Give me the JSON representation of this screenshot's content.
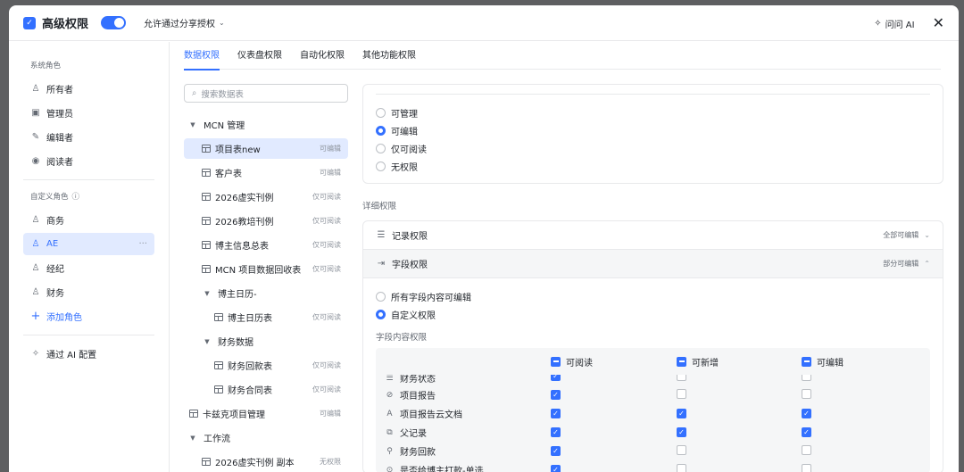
{
  "header": {
    "title": "高级权限",
    "share_label": "允许通过分享授权",
    "ask_ai": "问问 AI"
  },
  "sidebar": {
    "system_label": "系统角色",
    "system_roles": [
      "所有者",
      "管理员",
      "编辑者",
      "阅读者"
    ],
    "custom_label": "自定义角色",
    "custom_roles": [
      "商务",
      "AE",
      "经纪",
      "财务"
    ],
    "more": "···",
    "add_role": "添加角色",
    "ai_config": "通过 AI 配置"
  },
  "tabs": [
    "数据权限",
    "仪表盘权限",
    "自动化权限",
    "其他功能权限"
  ],
  "tree": {
    "search_placeholder": "搜索数据表",
    "nodes": [
      {
        "label": "MCN 管理",
        "perm": ""
      },
      {
        "label": "项目表new",
        "perm": "可编辑"
      },
      {
        "label": "客户表",
        "perm": "可编辑"
      },
      {
        "label": "2026虚实刊例",
        "perm": "仅可阅读"
      },
      {
        "label": "2026教培刊例",
        "perm": "仅可阅读"
      },
      {
        "label": "博主信息总表",
        "perm": "仅可阅读"
      },
      {
        "label": "MCN 项目数据回收表",
        "perm": "仅可阅读"
      },
      {
        "label": "博主日历-",
        "perm": ""
      },
      {
        "label": "博主日历表",
        "perm": "仅可阅读"
      },
      {
        "label": "财务数据",
        "perm": ""
      },
      {
        "label": "财务回款表",
        "perm": "仅可阅读"
      },
      {
        "label": "财务合同表",
        "perm": "仅可阅读"
      },
      {
        "label": "卡兹克项目管理",
        "perm": "可编辑"
      },
      {
        "label": "工作流",
        "perm": ""
      },
      {
        "label": "2026虚实刊例 副本",
        "perm": "无权限"
      }
    ]
  },
  "table_perm": {
    "options": [
      "可管理",
      "可编辑",
      "仅可阅读",
      "无权限"
    ],
    "selected": "可编辑"
  },
  "detail": {
    "label": "详细权限",
    "record": {
      "title": "记录权限",
      "value": "全部可编辑"
    },
    "field": {
      "title": "字段权限",
      "value": "部分可编辑"
    },
    "field_options": [
      "所有字段内容可编辑",
      "自定义权限"
    ],
    "field_selected": "自定义权限",
    "field_content_label": "字段内容权限",
    "columns": [
      "可阅读",
      "可新增",
      "可编辑"
    ],
    "partial_row": "财务状态",
    "rows": [
      {
        "name": "项目报告",
        "icon": "attachment-icon",
        "read": true,
        "add": false,
        "edit": false
      },
      {
        "name": "项目报告云文档",
        "icon": "text-format-icon",
        "read": true,
        "add": true,
        "edit": true
      },
      {
        "name": "父记录",
        "icon": "link-record-icon",
        "read": true,
        "add": true,
        "edit": true
      },
      {
        "name": "财务回款",
        "icon": "lookup-icon",
        "read": true,
        "add": false,
        "edit": false
      },
      {
        "name": "是否给博主打款-单选",
        "icon": "single-select-icon",
        "read": true,
        "add": false,
        "edit": false
      }
    ]
  },
  "colors": {
    "accent": "#3370ff",
    "active_bg": "#e1eaff"
  }
}
